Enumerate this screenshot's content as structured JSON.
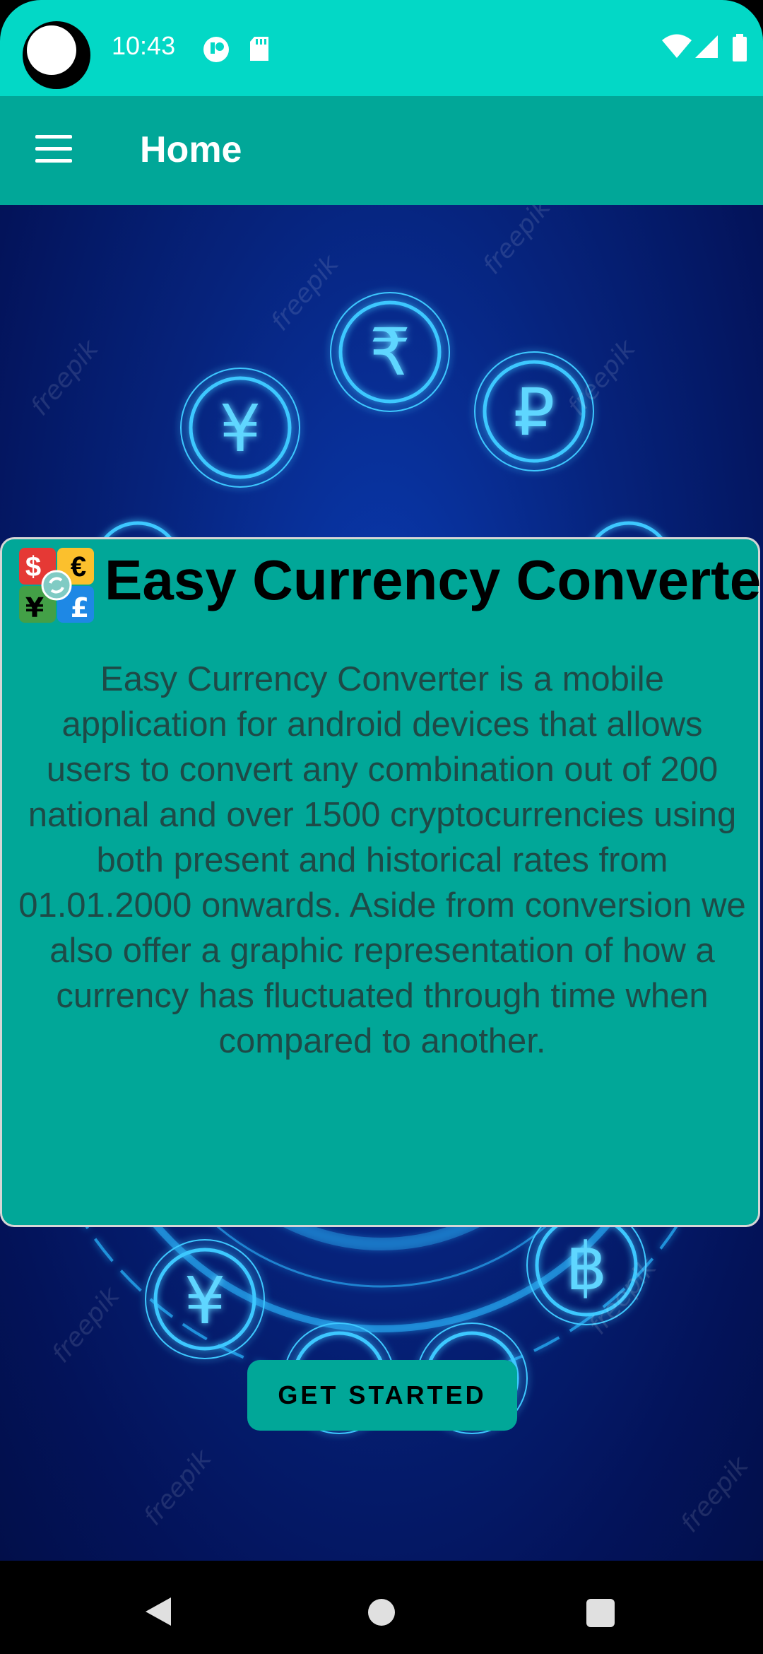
{
  "status_bar": {
    "time": "10:43",
    "notification_icons": [
      "app-notification-icon",
      "sd-card-icon"
    ],
    "system_icons": [
      "wifi-icon",
      "cellular-signal-icon",
      "battery-icon"
    ]
  },
  "app_bar": {
    "title": "Home",
    "menu_icon": "hamburger-menu-icon"
  },
  "hero": {
    "currency_symbols": [
      "¥",
      "₹",
      "₽",
      "¥",
      "₹",
      "$",
      "฿"
    ],
    "watermark": "freepik"
  },
  "card": {
    "title": "Easy Currency Converter",
    "app_icon_symbols": [
      "$",
      "€",
      "¥",
      "£"
    ],
    "description": "Easy Currency Converter is a mobile application for android devices that allows users to convert any combination out of 200 national and over 1500 cryptocurrencies using both present and historical rates from 01.01.2000 onwards. Aside from conversion we also offer a graphic representation of how a currency has fluctuated through time when compared to another."
  },
  "cta": {
    "label": "GET STARTED"
  },
  "nav_bar": {
    "buttons": [
      "back-icon",
      "home-icon",
      "recents-icon"
    ]
  },
  "colors": {
    "status_bar": "#03d8c6",
    "app_bar": "#01a798",
    "card": "#01a798",
    "hero_bg": "#06237c"
  }
}
